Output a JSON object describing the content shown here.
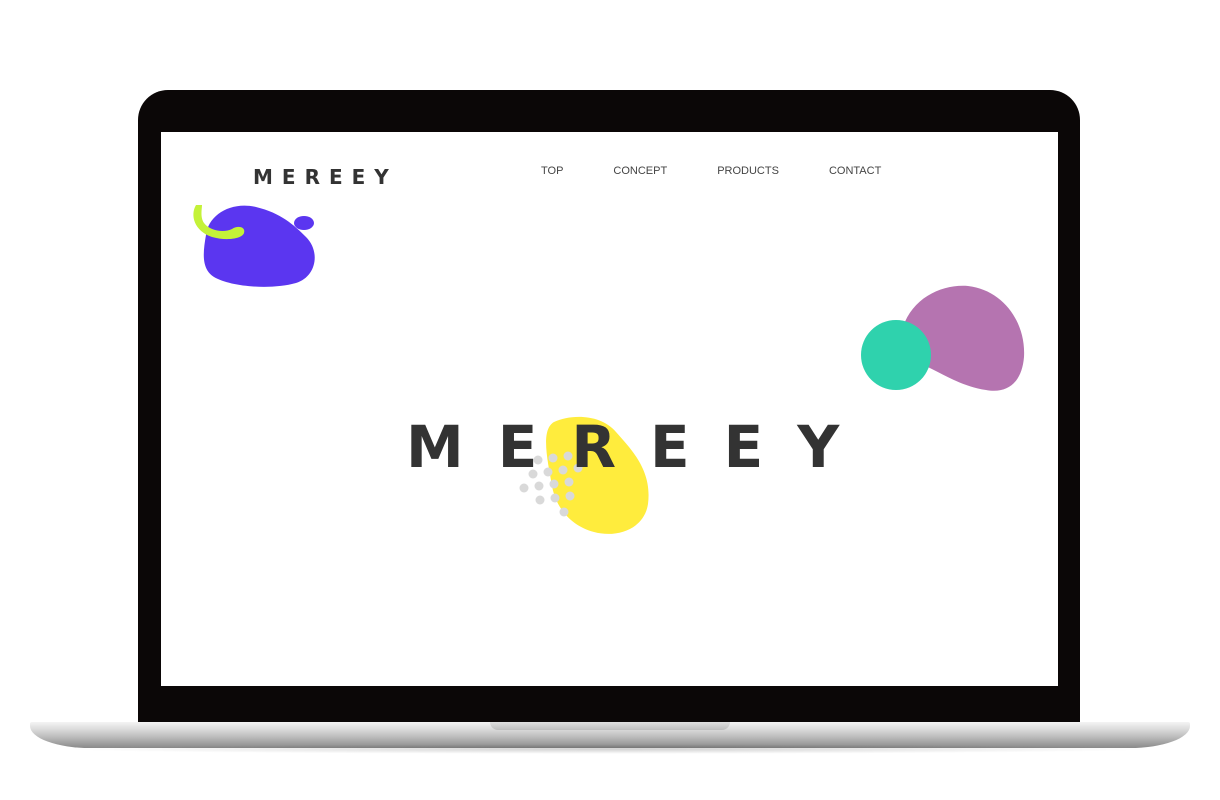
{
  "site": {
    "logo": "MEREEY",
    "nav": [
      "TOP",
      "CONCEPT",
      "PRODUCTS",
      "CONTACT"
    ],
    "hero_title": "MEREEY"
  },
  "colors": {
    "laptop_frame": "#0b0707",
    "text": "#333333",
    "blob_purple": "#5b36f0",
    "blob_lime": "#c4f238",
    "blob_mauve": "#b574b0",
    "blob_teal": "#2fd2ad",
    "blob_yellow": "#ffec3d",
    "dots_gray": "#d9d9d9"
  }
}
